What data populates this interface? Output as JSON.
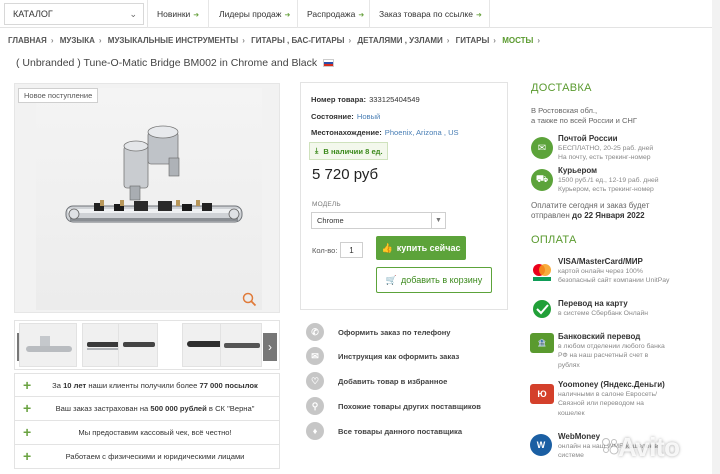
{
  "topnav": {
    "catalog_label": "КАТАЛОГ",
    "items": [
      "Новинки",
      "Лидеры продаж",
      "Распродажа",
      "Заказ товара по ссылке"
    ]
  },
  "breadcrumbs": [
    "ГЛАВНАЯ",
    "МУЗЫКА",
    "МУЗЫКАЛЬНЫЕ ИНСТРУМЕНТЫ",
    "ГИТАРЫ , БАС-ГИТАРЫ",
    "ДЕТАЛЯМИ , УЗЛАМИ",
    "ГИТАРЫ",
    "МОСТЫ"
  ],
  "product": {
    "title": "( Unbranded ) Tune-O-Matic Bridge BM002 in Chrome and Black",
    "badge": "Новое поступление",
    "number_label": "Номер товара:",
    "number_value": "333125404549",
    "condition_label": "Состояние:",
    "condition_value": "Новый",
    "location_label": "Местонахождение:",
    "location_value": "Phoenix, Arizona , US",
    "stock": "В наличии 8 ед.",
    "price": "5 720 руб",
    "model_label": "МОДЕЛЬ",
    "model_value": "Chrome",
    "qty_label": "Кол-во:",
    "qty_value": "1",
    "buy_label": "купить сейчас",
    "cart_label": "добавить в корзину"
  },
  "benefits": [
    {
      "pre": "За ",
      "b1": "10 лет",
      "mid": " наши клиенты получили более ",
      "b2": "77 000 посылок",
      "post": ""
    },
    {
      "pre": "Ваш заказ застрахован на ",
      "b1": "500 000 рублей",
      "mid": " в СК \"Верна\"",
      "b2": "",
      "post": ""
    },
    {
      "pre": "Мы предоставим кассовый чек, всё честно!",
      "b1": "",
      "mid": "",
      "b2": "",
      "post": ""
    },
    {
      "pre": "Работаем с физическими и юридическими лицами",
      "b1": "",
      "mid": "",
      "b2": "",
      "post": ""
    }
  ],
  "actions": [
    {
      "label": "Оформить заказ по телефону",
      "icon": "phone-icon"
    },
    {
      "label": "Инструкция как оформить заказ",
      "icon": "chat-icon"
    },
    {
      "label": "Добавить товар в избранное",
      "icon": "heart-icon"
    },
    {
      "label": "Похожие товары других поставщиков",
      "icon": "search-icon"
    },
    {
      "label": "Все товары данного поставщика",
      "icon": "tag-icon"
    }
  ],
  "delivery": {
    "heading": "ДОСТАВКА",
    "region_line1": "В Ростовская обл.,",
    "region_line2": "а также по всей России и СНГ",
    "post_title": "Почтой России",
    "post_line1": "БЕСПЛАТНО, 20-25 раб. дней",
    "post_line2": "На почту, есть трекинг-номер",
    "courier_title": "Курьером",
    "courier_line1": "1500 руб./1 ед., 12-19 раб. дней",
    "courier_line2": "Курьером, есть трекинг-номер",
    "ship_line1": "Оплатите сегодня и заказ будет",
    "ship_line2_pre": "отправлен ",
    "ship_line2_date": "до 22 Января 2022"
  },
  "payment": {
    "heading": "ОПЛАТА",
    "items": [
      {
        "title": "VISA/MasterCard/МИР",
        "l1": "картой онлайн через 100%",
        "l2": "безопасный сайт компании UnitPay",
        "l3": ""
      },
      {
        "title": "Перевод на карту",
        "l1": "в системе Сбербанк Онлайн",
        "l2": "",
        "l3": ""
      },
      {
        "title": "Банковский перевод",
        "l1": "в любом отделении любого банка",
        "l2": "РФ на наш расчетный счет в",
        "l3": "рублях"
      },
      {
        "title": "Yoomoney (Яндекс.Деньги)",
        "l1": "наличными в салоне Евросеть/",
        "l2": "Связной или переводом на",
        "l3": "кошелек"
      },
      {
        "title": "WebMoney",
        "l1": "онлайн на наш WMR кошелек в",
        "l2": "системе",
        "l3": ""
      }
    ]
  },
  "watermark": "Avito",
  "colors": {
    "accent": "#5ca33a",
    "link": "#4a7fb5",
    "icon_gray": "#c6c6c6"
  }
}
